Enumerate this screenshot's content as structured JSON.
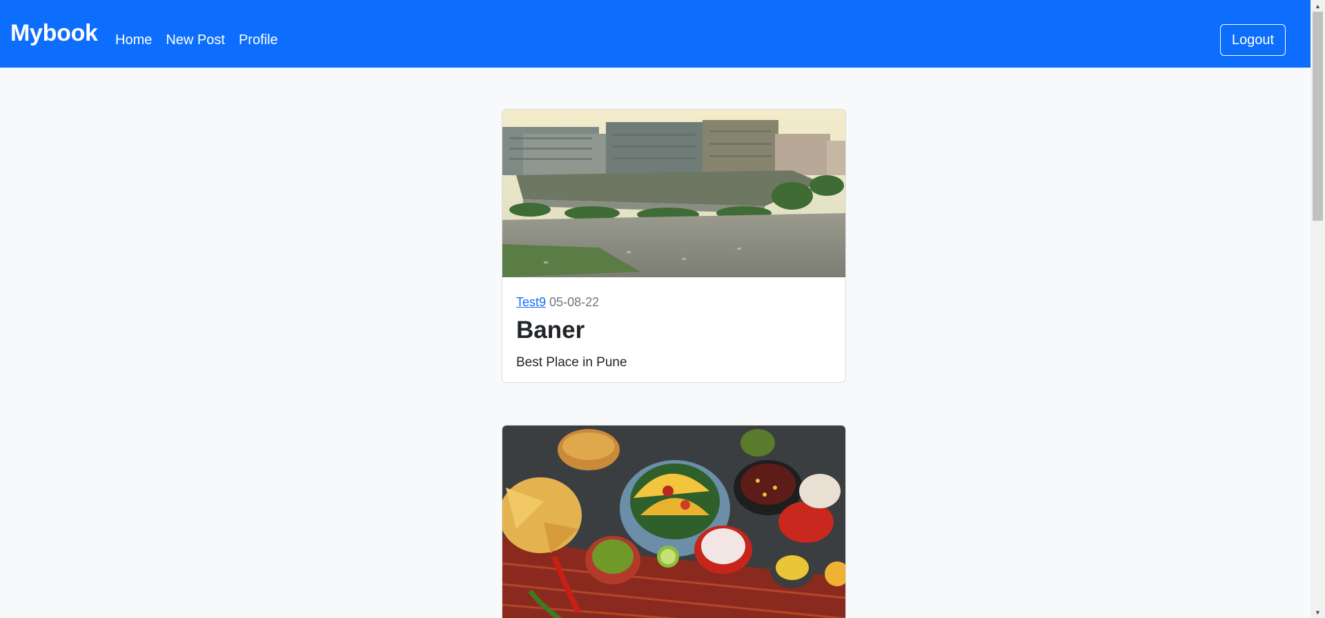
{
  "navbar": {
    "brand": "Mybook",
    "links": [
      {
        "label": "Home"
      },
      {
        "label": "New Post"
      },
      {
        "label": "Profile"
      }
    ],
    "logout_label": "Logout",
    "background": "#0d6efd"
  },
  "posts": [
    {
      "author": "Test9",
      "date": "05-08-22",
      "title": "Baner",
      "description": "Best Place in Pune",
      "image": "city-shopping-mall-aerial-photo"
    },
    {
      "image": "mexican-food-spread-photo"
    }
  ],
  "colors": {
    "accent": "#0d6efd",
    "page_bg": "#f8f9fb",
    "muted_text": "#6c757d",
    "body_text": "#212529"
  }
}
